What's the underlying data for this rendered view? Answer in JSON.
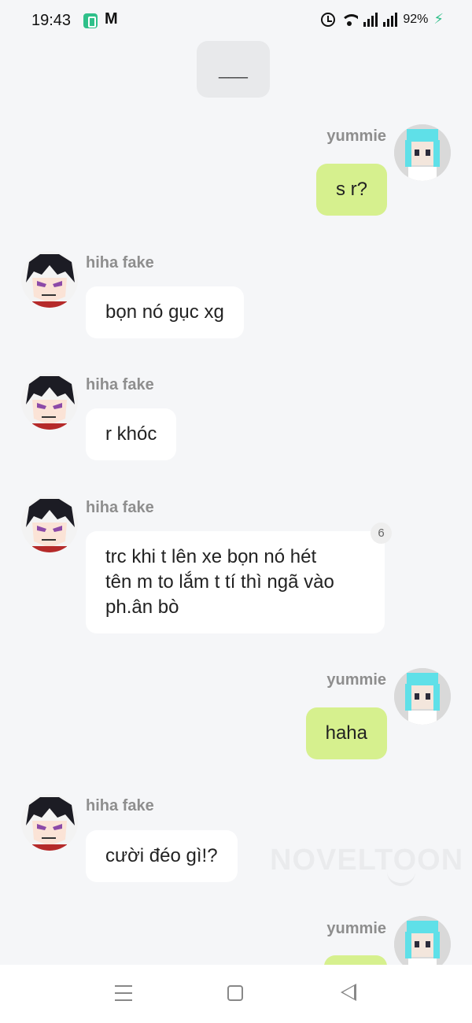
{
  "status_bar": {
    "time": "19:43",
    "battery": "92%",
    "icons": [
      "battery-saver-icon",
      "gmail-icon",
      "alarm-icon",
      "wifi-icon",
      "signal-icon",
      "signal-icon",
      "charging-icon"
    ]
  },
  "top_pill": {
    "text": "___"
  },
  "messages": [
    {
      "side": "right",
      "sender": "yummie",
      "text": "s r?",
      "avatar": "cyan-hair-avatar"
    },
    {
      "side": "left",
      "sender": "hiha fake",
      "text": "bọn nó gục xg",
      "avatar": "dark-hair-avatar"
    },
    {
      "side": "left",
      "sender": "hiha fake",
      "text": "r khóc",
      "avatar": "dark-hair-avatar"
    },
    {
      "side": "left",
      "sender": "hiha fake",
      "text_lines": [
        "trc khi t lên xe bọn nó hét",
        "tên m to lắm t tí thì ngã vào",
        "ph.ân bò"
      ],
      "badge": "6",
      "avatar": "dark-hair-avatar"
    },
    {
      "side": "right",
      "sender": "yummie",
      "text": "haha",
      "avatar": "cyan-hair-avatar"
    },
    {
      "side": "left",
      "sender": "hiha fake",
      "text": "cười đéo gì!?",
      "avatar": "dark-hair-avatar"
    },
    {
      "side": "right",
      "sender": "yummie",
      "text": "",
      "avatar": "cyan-hair-avatar"
    }
  ],
  "watermark": "NOVELTOON",
  "colors": {
    "background": "#f5f6f8",
    "left_bubble": "#ffffff",
    "right_bubble": "#d6f08e",
    "sender_name": "#8e8e8e"
  },
  "nav_bar": {
    "icons": [
      "menu-icon",
      "home-icon",
      "back-icon"
    ]
  }
}
